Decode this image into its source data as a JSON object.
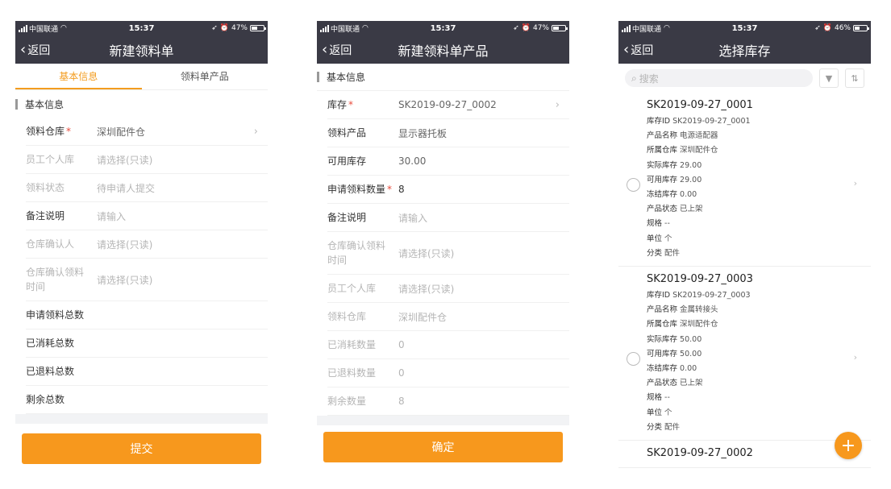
{
  "status": {
    "carrier": "中国联通",
    "time": "15:37",
    "battery1": "47%",
    "battery2": "47%",
    "battery3": "46%",
    "battery_fill1": 0.47,
    "battery_fill2": 0.47,
    "battery_fill3": 0.46
  },
  "screen1": {
    "back": "返回",
    "title": "新建领料单",
    "tabs": [
      "基本信息",
      "领料单产品"
    ],
    "section": "基本信息",
    "rows": [
      {
        "label": "领料仓库",
        "value": "深圳配件仓"
      },
      {
        "label": "员工个人库",
        "value": "请选择(只读)"
      },
      {
        "label": "领料状态",
        "value": "待申请人提交"
      },
      {
        "label": "备注说明",
        "value": "请输入"
      },
      {
        "label": "仓库确认人",
        "value": "请选择(只读)"
      },
      {
        "label": "仓库确认领料时间",
        "value": "请选择(只读)"
      },
      {
        "label": "申请领料总数",
        "value": ""
      },
      {
        "label": "已消耗总数",
        "value": ""
      },
      {
        "label": "已退料总数",
        "value": ""
      },
      {
        "label": "剩余总数",
        "value": ""
      }
    ],
    "submit": "提交"
  },
  "screen2": {
    "back": "返回",
    "title": "新建领料单产品",
    "section": "基本信息",
    "rows": [
      {
        "label": "库存",
        "value": "SK2019-09-27_0002"
      },
      {
        "label": "领料产品",
        "value": "显示器托板"
      },
      {
        "label": "可用库存",
        "value": "30.00"
      },
      {
        "label": "申请领料数量",
        "value": "8"
      },
      {
        "label": "备注说明",
        "value": "请输入"
      },
      {
        "label": "仓库确认领料时间",
        "value": "请选择(只读)"
      },
      {
        "label": "员工个人库",
        "value": "请选择(只读)"
      },
      {
        "label": "领料仓库",
        "value": "深圳配件仓"
      },
      {
        "label": "已消耗数量",
        "value": "0"
      },
      {
        "label": "已退料数量",
        "value": "0"
      },
      {
        "label": "剩余数量",
        "value": "8"
      }
    ],
    "submit": "确定"
  },
  "screen3": {
    "back": "返回",
    "title": "选择库存",
    "search_placeholder": "搜索",
    "cards": [
      {
        "code": "SK2019-09-27_0001",
        "fields": [
          {
            "k": "库存ID",
            "v": "SK2019-09-27_0001"
          },
          {
            "k": "产品名称",
            "v": "电源适配器"
          },
          {
            "k": "所属仓库",
            "v": "深圳配件仓"
          },
          {
            "k": "实际库存",
            "v": "29.00"
          },
          {
            "k": "可用库存",
            "v": "29.00"
          },
          {
            "k": "冻结库存",
            "v": "0.00"
          },
          {
            "k": "产品状态",
            "v": "已上架"
          },
          {
            "k": "规格",
            "v": "--"
          },
          {
            "k": "单位",
            "v": "个"
          },
          {
            "k": "分类",
            "v": "配件"
          }
        ]
      },
      {
        "code": "SK2019-09-27_0003",
        "fields": [
          {
            "k": "库存ID",
            "v": "SK2019-09-27_0003"
          },
          {
            "k": "产品名称",
            "v": "金属转接头"
          },
          {
            "k": "所属仓库",
            "v": "深圳配件仓"
          },
          {
            "k": "实际库存",
            "v": "50.00"
          },
          {
            "k": "可用库存",
            "v": "50.00"
          },
          {
            "k": "冻结库存",
            "v": "0.00"
          },
          {
            "k": "产品状态",
            "v": "已上架"
          },
          {
            "k": "规格",
            "v": "--"
          },
          {
            "k": "单位",
            "v": "个"
          },
          {
            "k": "分类",
            "v": "配件"
          }
        ]
      },
      {
        "code": "SK2019-09-27_0002",
        "fields": []
      }
    ]
  }
}
